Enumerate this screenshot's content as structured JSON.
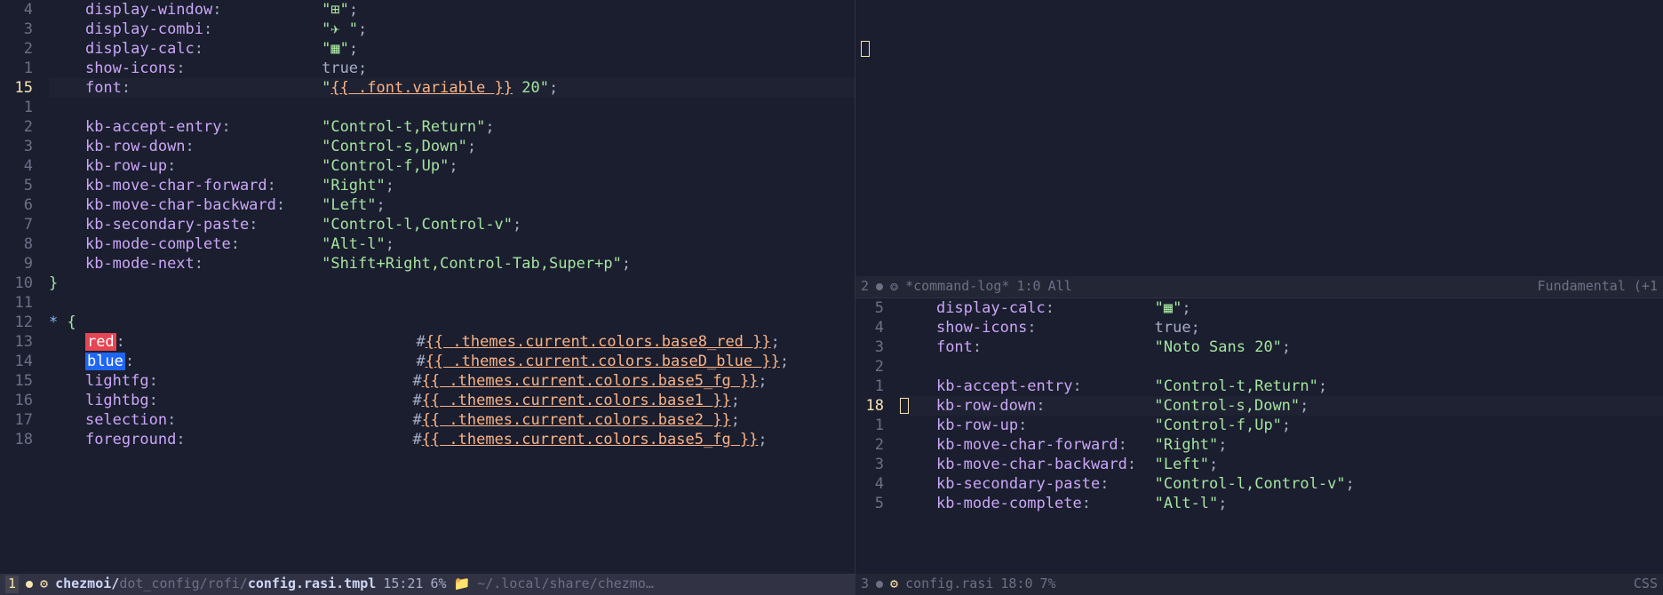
{
  "left": {
    "gutter": [
      "4",
      "3",
      "2",
      "1",
      "15",
      "1",
      "2",
      "3",
      "4",
      "5",
      "6",
      "7",
      "8",
      "9",
      "10",
      "11",
      "12",
      "13",
      "14",
      "15",
      "16",
      "17",
      "18"
    ],
    "lines": [
      {
        "key": "display-window",
        "val": "\"⊞\"",
        "type": "str"
      },
      {
        "key": "display-combi",
        "val": "\"✈ \"",
        "type": "str"
      },
      {
        "key": "display-calc",
        "val": "\"▦\"",
        "type": "str"
      },
      {
        "key": "show-icons",
        "val": "true",
        "type": "bool"
      },
      {
        "key": "font",
        "val_pre": "\"",
        "tmpl": "{{ .font.variable }}",
        "val_post": " 20\"",
        "type": "tmpl",
        "highlight": true
      },
      {
        "blank": true
      },
      {
        "key": "kb-accept-entry",
        "val": "\"Control-t,Return\"",
        "type": "str"
      },
      {
        "key": "kb-row-down",
        "val": "\"Control-s,Down\"",
        "type": "str"
      },
      {
        "key": "kb-row-up",
        "val": "\"Control-f,Up\"",
        "type": "str"
      },
      {
        "key": "kb-move-char-forward",
        "val": "\"Right\"",
        "type": "str"
      },
      {
        "key": "kb-move-char-backward",
        "val": "\"Left\"",
        "type": "str"
      },
      {
        "key": "kb-secondary-paste",
        "val": "\"Control-l,Control-v\"",
        "type": "str"
      },
      {
        "key": "kb-mode-complete",
        "val": "\"Alt-l\"",
        "type": "str"
      },
      {
        "key": "kb-mode-next",
        "val": "\"Shift+Right,Control-Tab,Super+p\"",
        "type": "str"
      },
      {
        "brace": "}",
        "type": "brace"
      },
      {
        "blank": true
      },
      {
        "sel": "* {",
        "type": "sel"
      },
      {
        "key_hl": "red",
        "tmpl": "{{ .themes.current.colors.base8_red }}",
        "type": "color",
        "hl": "red"
      },
      {
        "key_hl": "blue",
        "tmpl": "{{ .themes.current.colors.baseD_blue }}",
        "type": "color",
        "hl": "blue"
      },
      {
        "key": "lightfg",
        "tmpl": "{{ .themes.current.colors.base5_fg }}",
        "type": "color"
      },
      {
        "key": "lightbg",
        "tmpl": "{{ .themes.current.colors.base1 }}",
        "type": "color"
      },
      {
        "key": "selection",
        "tmpl": "{{ .themes.current.colors.base2 }}",
        "type": "color"
      },
      {
        "key": "foreground",
        "tmpl": "{{ .themes.current.colors.base5_fg }}",
        "type": "color",
        "cut": true
      }
    ],
    "modeline": {
      "num": "1",
      "icon": "css",
      "path_pre": "chezmoi/",
      "path_dim": "dot_config/rofi/",
      "file": "config.rasi.tmpl",
      "pos": "15:21",
      "pct": "6%",
      "folder": "~/.local/share/chezmo…"
    }
  },
  "right_top": {
    "modeline": {
      "num": "2",
      "name": "*command-log*",
      "pos": "1:0",
      "pct": "All",
      "mode": "Fundamental (+1"
    }
  },
  "right_bottom": {
    "gutter": [
      "5",
      "4",
      "3",
      "2",
      "1",
      "18",
      "1",
      "2",
      "3",
      "4",
      "5"
    ],
    "lines": [
      {
        "key": "display-calc",
        "val": "\"▦\"",
        "type": "str"
      },
      {
        "key": "show-icons",
        "val": "true",
        "type": "bool"
      },
      {
        "key": "font",
        "val": "\"Noto Sans 20\"",
        "type": "str"
      },
      {
        "blank": true
      },
      {
        "key": "kb-accept-entry",
        "val": "\"Control-t,Return\"",
        "type": "str"
      },
      {
        "key": "kb-row-down",
        "val": "\"Control-s,Down\"",
        "type": "str",
        "highlight": true,
        "cursor": true
      },
      {
        "key": "kb-row-up",
        "val": "\"Control-f,Up\"",
        "type": "str"
      },
      {
        "key": "kb-move-char-forward",
        "val": "\"Right\"",
        "type": "str"
      },
      {
        "key": "kb-move-char-backward",
        "val": "\"Left\"",
        "type": "str"
      },
      {
        "key": "kb-secondary-paste",
        "val": "\"Control-l,Control-v\"",
        "type": "str"
      },
      {
        "key": "kb-mode-complete",
        "val": "\"Alt-l\"",
        "type": "str",
        "cut": true
      }
    ],
    "modeline": {
      "num": "3",
      "file": "config.rasi",
      "pos": "18:0",
      "pct": "7%",
      "lang": "CSS"
    }
  },
  "column_keys": 24,
  "column_vals": 30
}
